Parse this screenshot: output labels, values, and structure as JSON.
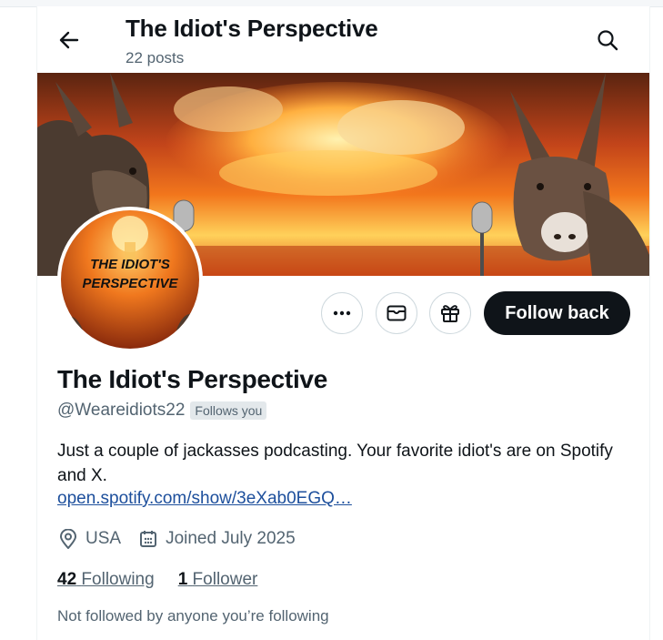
{
  "header": {
    "title": "The Idiot's Perspective",
    "posts_count": "22 posts",
    "back_icon": "arrow-left-icon",
    "search_icon": "search-icon"
  },
  "banner": {
    "description_icons": [
      "donkey",
      "explosion",
      "microphone"
    ],
    "colors": {
      "sky_top": "#5a2410",
      "fire": "#f2761c",
      "glow": "#ffd15a"
    }
  },
  "avatar": {
    "logo_line1": "THE IDIOT'S",
    "logo_line2": "PERSPECTIVE"
  },
  "actions": {
    "more_icon": "more-icon",
    "message_icon": "mail-icon",
    "gift_icon": "gift-icon",
    "follow_back_label": "Follow back"
  },
  "profile": {
    "name": "The Idiot's Perspective",
    "handle": "@Weareidiots22",
    "follows_you_badge": "Follows you",
    "bio": "Just a couple of jackasses podcasting. Your favorite idiot's are on Spotify and X.",
    "link": "open.spotify.com/show/3eXab0EGQ…",
    "location": "USA",
    "joined": "Joined July 2025",
    "following_count": "42",
    "following_label": "Following",
    "followers_count": "1",
    "followers_label": "Follower",
    "not_followed_note": "Not followed by anyone you’re following"
  },
  "colors": {
    "primary_text": "#0f1419",
    "secondary_text": "#536471",
    "link": "#1d4f9c",
    "button_dark": "#0f1419"
  }
}
